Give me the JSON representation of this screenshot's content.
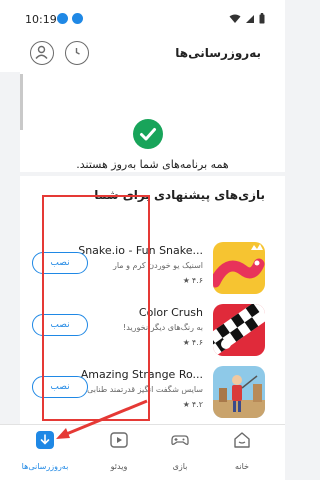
{
  "status_bar": {
    "time": "10:19"
  },
  "header": {
    "title": "به‌روزرسانی‌ها"
  },
  "updates": {
    "message": "همه برنامه‌های شما به‌روز هستند."
  },
  "suggested": {
    "title": "بازی‌های پیشنهادی برای شما",
    "apps": [
      {
        "name": "Snake.io - Fun Snake...",
        "desc": "اسنیک یو خوردن کرم و مار",
        "rating": "۴.۶",
        "install_label": "نصب"
      },
      {
        "name": "Color Crush",
        "desc": "به رنگ‌های دیگر نخورید!",
        "rating": "۴.۶",
        "install_label": "نصب"
      },
      {
        "name": "Amazing Strange Ro...",
        "desc": "سایس شگفت انگیز قدرتمند طنابی",
        "rating": "۴.۲",
        "install_label": "نصب"
      }
    ]
  },
  "nav": {
    "items": [
      {
        "label": "خانه"
      },
      {
        "label": "بازی"
      },
      {
        "label": "ویدئو"
      },
      {
        "label": "به‌روزرسانی‌ها"
      }
    ]
  },
  "colors": {
    "accent": "#1f88e5",
    "success": "#18a45a",
    "annotation": "#e53935"
  }
}
